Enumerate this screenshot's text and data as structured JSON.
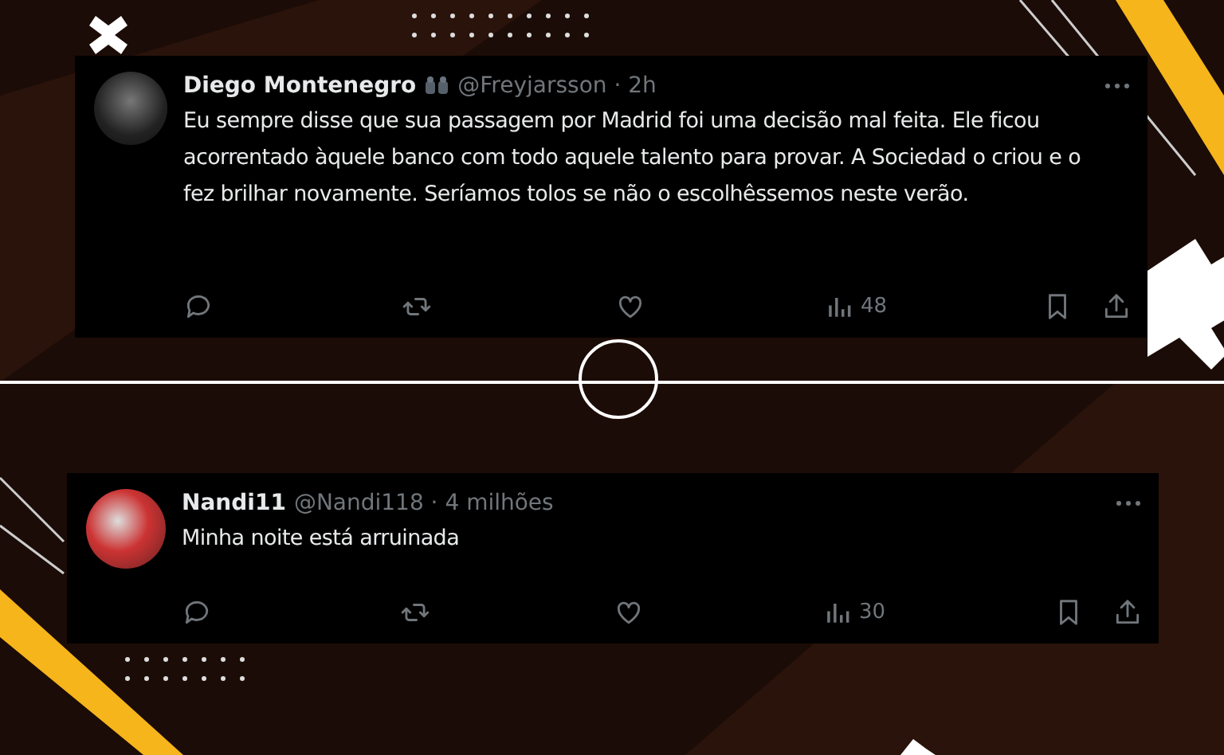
{
  "tweets": [
    {
      "name": "Diego Montenegro",
      "has_emoji": true,
      "meta": "@Freyjarsson · 2h",
      "text": "Eu sempre disse que sua passagem por Madrid foi uma decisão mal feita. Ele ficou acorrentado àquele banco com todo aquele talento para provar. A Sociedad o criou e o fez brilhar novamente. Seríamos tolos se não o escolhêssemos neste verão.",
      "views": "48"
    },
    {
      "name": "Nandi11",
      "has_emoji": false,
      "meta": "@Nandi118 · 4 milhões",
      "text": "Minha noite está arruinada",
      "views": "30"
    }
  ]
}
